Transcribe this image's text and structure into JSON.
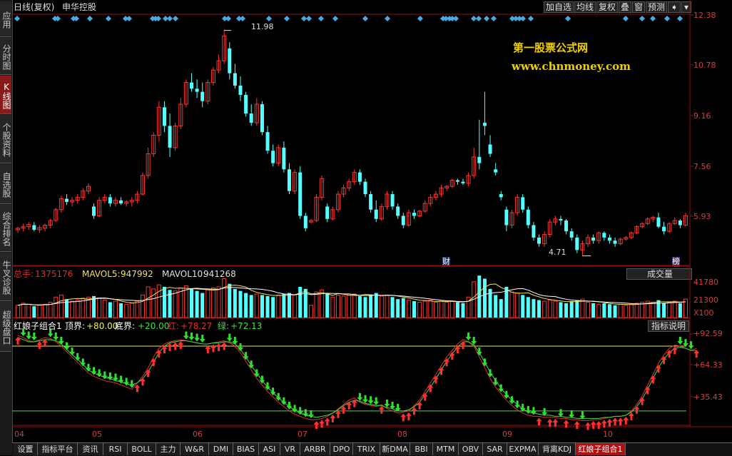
{
  "left_tabs": [
    {
      "label": "应用",
      "active": false
    },
    {
      "label": "分时图",
      "active": false
    },
    {
      "label": "K线图",
      "active": true
    },
    {
      "label": "个股资料",
      "active": false
    },
    {
      "label": "自选股",
      "active": false
    },
    {
      "label": "综合排名",
      "active": false
    },
    {
      "label": "牛叉诊股",
      "active": false
    },
    {
      "label": "超级盘口",
      "active": false
    }
  ],
  "header": {
    "title": "日线(复权)",
    "stock_name": "申华控股",
    "buttons": [
      "加自选",
      "均线",
      "复权",
      "叠",
      "窗",
      "预测"
    ]
  },
  "watermark": {
    "line1": "第一股票公式网",
    "line2": "www.chnmoney.com"
  },
  "price_axis": {
    "labels": [
      "12.38",
      "10.78",
      "9.16",
      "7.56",
      "5.93"
    ]
  },
  "price_annotations": {
    "high": "11.98",
    "low": "4.71",
    "marker_cai": "财",
    "marker_bang": "榜"
  },
  "volume_panel": {
    "total_label": "总手:",
    "total_value": "1375176",
    "mavol5_label": "MAVOL5:",
    "mavol5_value": "947992",
    "mavol10_label": "MAVOL10:",
    "mavol10_value": "941268",
    "selector": "成交量",
    "axis": [
      "41780",
      "21300",
      "X100"
    ]
  },
  "indicator_panel": {
    "name": "红娘子组合1",
    "top_label": "顶界:",
    "top_value": "+80.00",
    "bottom_label": "底界:",
    "bottom_value": "+20.00",
    "red_label": "红:",
    "red_value": "+78.27",
    "green_label": "绿:",
    "green_value": "+72.13",
    "help_button": "指标说明",
    "axis": [
      "+92.59",
      "+64.33",
      "+35.43"
    ]
  },
  "x_axis": [
    "04",
    "05",
    "06",
    "07",
    "08",
    "09",
    "10"
  ],
  "bottom_tabs": [
    "设置",
    "指标平台",
    "资讯",
    "RSI",
    "BOLL",
    "主力",
    "W&R",
    "DMI",
    "BIAS",
    "ASI",
    "VR",
    "ARBR",
    "DPO",
    "TRIX",
    "新DMA",
    "BBI",
    "MTM",
    "OBV",
    "SAR",
    "EXPMA",
    "背离KDJ",
    "红娘子组合1"
  ],
  "active_bottom_tab": "红娘子组合1",
  "chart_data": {
    "type": "candlestick",
    "ylim": [
      4.4,
      12.5
    ],
    "ohlc": [
      [
        5.55,
        5.65,
        5.45,
        5.6
      ],
      [
        5.6,
        5.75,
        5.5,
        5.65
      ],
      [
        5.65,
        5.8,
        5.55,
        5.72
      ],
      [
        5.7,
        5.8,
        5.5,
        5.55
      ],
      [
        5.55,
        5.7,
        5.45,
        5.62
      ],
      [
        5.6,
        5.75,
        5.5,
        5.7
      ],
      [
        5.7,
        5.9,
        5.6,
        5.85
      ],
      [
        5.85,
        6.25,
        5.8,
        6.2
      ],
      [
        6.2,
        6.65,
        6.1,
        6.55
      ],
      [
        6.55,
        6.7,
        6.35,
        6.45
      ],
      [
        6.45,
        6.6,
        6.3,
        6.5
      ],
      [
        6.5,
        6.7,
        6.4,
        6.6
      ],
      [
        6.6,
        6.9,
        6.5,
        6.8
      ],
      [
        6.8,
        7.05,
        6.7,
        6.95
      ],
      [
        6.3,
        6.4,
        5.9,
        6.0
      ],
      [
        6.0,
        6.6,
        5.95,
        6.5
      ],
      [
        6.5,
        6.7,
        6.4,
        6.6
      ],
      [
        6.6,
        6.7,
        6.3,
        6.4
      ],
      [
        6.4,
        6.6,
        6.3,
        6.5
      ],
      [
        6.5,
        6.6,
        6.35,
        6.4
      ],
      [
        6.4,
        6.5,
        6.3,
        6.45
      ],
      [
        6.45,
        6.6,
        6.3,
        6.5
      ],
      [
        6.5,
        6.8,
        6.4,
        6.7
      ],
      [
        6.7,
        7.4,
        6.65,
        7.3
      ],
      [
        7.3,
        8.2,
        7.2,
        8.0
      ],
      [
        8.0,
        8.7,
        7.9,
        8.6
      ],
      [
        8.6,
        9.7,
        8.4,
        9.5
      ],
      [
        9.5,
        9.7,
        8.7,
        8.9
      ],
      [
        8.9,
        9.3,
        7.9,
        8.2
      ],
      [
        8.2,
        9.0,
        8.1,
        8.9
      ],
      [
        8.9,
        9.8,
        8.8,
        9.6
      ],
      [
        9.6,
        10.4,
        9.5,
        10.3
      ],
      [
        10.3,
        10.6,
        10.0,
        10.1
      ],
      [
        10.1,
        10.4,
        9.8,
        10.0
      ],
      [
        10.0,
        10.3,
        9.5,
        9.7
      ],
      [
        9.7,
        10.4,
        9.6,
        10.3
      ],
      [
        10.3,
        10.8,
        10.2,
        10.7
      ],
      [
        10.7,
        11.2,
        10.6,
        11.0
      ],
      [
        11.0,
        12.0,
        10.9,
        11.8
      ],
      [
        11.4,
        11.6,
        10.4,
        10.6
      ],
      [
        10.6,
        10.9,
        10.1,
        10.2
      ],
      [
        10.2,
        10.5,
        9.7,
        9.9
      ],
      [
        9.9,
        10.0,
        9.2,
        9.3
      ],
      [
        9.3,
        9.6,
        8.9,
        9.0
      ],
      [
        9.0,
        9.8,
        8.9,
        9.6
      ],
      [
        9.6,
        9.7,
        8.6,
        8.7
      ],
      [
        8.7,
        8.9,
        8.0,
        8.1
      ],
      [
        8.1,
        8.3,
        7.6,
        7.7
      ],
      [
        7.7,
        8.3,
        7.6,
        8.2
      ],
      [
        8.2,
        8.4,
        7.4,
        7.5
      ],
      [
        7.5,
        7.7,
        6.7,
        6.8
      ],
      [
        6.8,
        7.5,
        6.7,
        7.4
      ],
      [
        7.4,
        7.6,
        5.9,
        6.0
      ],
      [
        6.0,
        6.1,
        5.5,
        5.6
      ],
      [
        5.8,
        5.9,
        5.75,
        5.85
      ],
      [
        5.85,
        6.7,
        5.8,
        6.6
      ],
      [
        6.6,
        7.3,
        6.5,
        7.2
      ],
      [
        6.3,
        6.4,
        5.8,
        5.9
      ],
      [
        5.9,
        6.3,
        5.85,
        6.2
      ],
      [
        6.2,
        6.8,
        6.1,
        6.7
      ],
      [
        6.7,
        7.0,
        6.6,
        6.9
      ],
      [
        6.9,
        7.2,
        6.8,
        7.1
      ],
      [
        7.1,
        7.5,
        7.0,
        7.4
      ],
      [
        7.4,
        7.5,
        7.0,
        7.1
      ],
      [
        7.1,
        7.2,
        6.6,
        6.7
      ],
      [
        6.7,
        6.8,
        6.1,
        6.2
      ],
      [
        6.2,
        6.5,
        5.8,
        5.9
      ],
      [
        5.9,
        6.4,
        5.85,
        6.3
      ],
      [
        6.3,
        6.8,
        6.2,
        6.7
      ],
      [
        6.7,
        6.8,
        6.2,
        6.3
      ],
      [
        6.3,
        6.4,
        5.9,
        6.0
      ],
      [
        6.0,
        6.1,
        5.6,
        5.7
      ],
      [
        5.7,
        6.2,
        5.65,
        6.1
      ],
      [
        6.1,
        6.2,
        5.9,
        6.0
      ],
      [
        6.0,
        6.2,
        5.95,
        6.15
      ],
      [
        6.15,
        6.5,
        6.1,
        6.4
      ],
      [
        6.4,
        6.7,
        6.3,
        6.6
      ],
      [
        6.6,
        6.8,
        6.5,
        6.7
      ],
      [
        6.7,
        7.0,
        6.6,
        6.9
      ],
      [
        6.9,
        7.0,
        6.8,
        6.95
      ],
      [
        6.95,
        7.2,
        6.9,
        7.15
      ],
      [
        7.15,
        7.2,
        7.0,
        7.1
      ],
      [
        7.1,
        7.2,
        7.0,
        7.05
      ],
      [
        7.05,
        7.4,
        6.95,
        7.3
      ],
      [
        7.3,
        8.2,
        7.2,
        7.9
      ],
      [
        7.9,
        9.1,
        7.5,
        7.7
      ],
      [
        9.0,
        10.0,
        8.6,
        8.9
      ],
      [
        8.3,
        8.6,
        7.9,
        8.0
      ],
      [
        7.5,
        7.7,
        7.3,
        7.4
      ],
      [
        6.7,
        6.8,
        6.5,
        6.6
      ],
      [
        6.2,
        6.3,
        5.5,
        5.7
      ],
      [
        5.7,
        6.2,
        5.6,
        6.1
      ],
      [
        6.1,
        6.7,
        6.0,
        6.6
      ],
      [
        6.6,
        6.7,
        6.1,
        6.2
      ],
      [
        6.2,
        6.3,
        5.6,
        5.7
      ],
      [
        5.7,
        5.8,
        5.2,
        5.3
      ],
      [
        5.3,
        5.4,
        5.0,
        5.1
      ],
      [
        5.1,
        5.5,
        5.0,
        5.4
      ],
      [
        5.4,
        5.9,
        5.3,
        5.8
      ],
      [
        5.8,
        6.0,
        5.7,
        5.9
      ],
      [
        5.9,
        6.0,
        5.7,
        5.85
      ],
      [
        5.85,
        5.9,
        5.4,
        5.5
      ],
      [
        5.5,
        5.6,
        5.2,
        5.3
      ],
      [
        5.3,
        5.4,
        4.8,
        4.9
      ],
      [
        4.9,
        5.2,
        4.71,
        5.1
      ],
      [
        5.1,
        5.4,
        5.0,
        5.3
      ],
      [
        5.3,
        5.4,
        5.1,
        5.2
      ],
      [
        5.2,
        5.5,
        5.1,
        5.45
      ],
      [
        5.45,
        5.5,
        5.2,
        5.3
      ],
      [
        5.3,
        5.4,
        5.1,
        5.2
      ],
      [
        5.2,
        5.3,
        5.0,
        5.1
      ],
      [
        5.1,
        5.3,
        5.05,
        5.25
      ],
      [
        5.25,
        5.35,
        5.2,
        5.3
      ],
      [
        5.3,
        5.5,
        5.25,
        5.45
      ],
      [
        5.45,
        5.7,
        5.4,
        5.65
      ],
      [
        5.65,
        5.8,
        5.6,
        5.75
      ],
      [
        5.75,
        5.95,
        5.7,
        5.9
      ],
      [
        5.9,
        6.0,
        5.8,
        5.95
      ],
      [
        5.95,
        6.1,
        5.6,
        5.65
      ],
      [
        5.65,
        5.8,
        5.4,
        5.5
      ],
      [
        5.5,
        5.8,
        5.45,
        5.75
      ],
      [
        5.75,
        5.95,
        5.7,
        5.85
      ],
      [
        5.85,
        5.9,
        5.6,
        5.7
      ],
      [
        5.7,
        6.1,
        5.65,
        6.0
      ]
    ],
    "volume": [
      12,
      14,
      13,
      11,
      12,
      13,
      15,
      20,
      22,
      18,
      16,
      17,
      19,
      20,
      21,
      19,
      17,
      15,
      16,
      14,
      13,
      14,
      16,
      22,
      30,
      28,
      32,
      30,
      27,
      26,
      29,
      31,
      28,
      26,
      24,
      27,
      29,
      30,
      38,
      33,
      28,
      26,
      24,
      22,
      23,
      22,
      21,
      20,
      22,
      23,
      24,
      22,
      30,
      28,
      12,
      25,
      27,
      24,
      20,
      22,
      21,
      22,
      23,
      21,
      20,
      22,
      24,
      21,
      22,
      20,
      18,
      19,
      17,
      16,
      15,
      16,
      17,
      15,
      16,
      15,
      16,
      15,
      14,
      20,
      35,
      41,
      38,
      28,
      22,
      18,
      30,
      25,
      24,
      22,
      20,
      18,
      17,
      16,
      17,
      16,
      15,
      14,
      16,
      17,
      18,
      15,
      14,
      13,
      14,
      13,
      12,
      13,
      12,
      13,
      14,
      15,
      16,
      15,
      17,
      14,
      15,
      16,
      14,
      18
    ],
    "indicator": {
      "series": [
        {
          "name": "红",
          "values": [
            90,
            88,
            85,
            84,
            86,
            88,
            87,
            84,
            80,
            75,
            70,
            65,
            60,
            55,
            52,
            50,
            48,
            47,
            46,
            44,
            42,
            40,
            46,
            52,
            60,
            70,
            78,
            82,
            84,
            85,
            86,
            85,
            84,
            83,
            82,
            82,
            83,
            84,
            85,
            83,
            80,
            74,
            66,
            58,
            50,
            44,
            38,
            33,
            28,
            24,
            20,
            17,
            15,
            13,
            12,
            12,
            13,
            15,
            18,
            22,
            26,
            30,
            32,
            28,
            26,
            25,
            24,
            26,
            22,
            20,
            18,
            19,
            20,
            25,
            30,
            38,
            46,
            54,
            62,
            70,
            76,
            82,
            86,
            84,
            80,
            70,
            60,
            50,
            42,
            36,
            30,
            25,
            21,
            18,
            16,
            15,
            15,
            14,
            14,
            14,
            13,
            13,
            12,
            12,
            11,
            11,
            12,
            12,
            13,
            14,
            15,
            15,
            16,
            20,
            26,
            34,
            44,
            54,
            64,
            72,
            78,
            81,
            80,
            78,
            76,
            78
          ]
        },
        {
          "name": "绿",
          "values": [
            88,
            86,
            84,
            84,
            85,
            86,
            86,
            85,
            82,
            77,
            72,
            68,
            63,
            58,
            55,
            53,
            51,
            50,
            48,
            47,
            45,
            44,
            46,
            50,
            56,
            65,
            74,
            80,
            83,
            84,
            85,
            85,
            84,
            83,
            82,
            82,
            83,
            83,
            84,
            84,
            82,
            77,
            70,
            62,
            55,
            48,
            42,
            37,
            32,
            28,
            24,
            21,
            18,
            16,
            15,
            14,
            15,
            16,
            18,
            21,
            25,
            28,
            30,
            29,
            27,
            26,
            25,
            25,
            23,
            22,
            20,
            20,
            21,
            24,
            28,
            35,
            42,
            50,
            58,
            66,
            73,
            79,
            84,
            84,
            81,
            74,
            65,
            56,
            48,
            41,
            35,
            30,
            26,
            22,
            19,
            18,
            17,
            16,
            16,
            15,
            15,
            14,
            14,
            13,
            13,
            13,
            13,
            13,
            14,
            14,
            15,
            15,
            16,
            19,
            24,
            31,
            40,
            50,
            60,
            68,
            74,
            78,
            79,
            78,
            76,
            76
          ]
        }
      ],
      "top": 80,
      "bottom": 20
    }
  }
}
